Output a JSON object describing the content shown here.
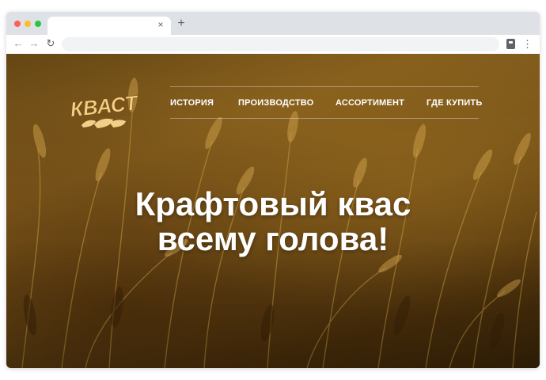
{
  "browser": {
    "tab_close": "×",
    "new_tab": "+",
    "back": "←",
    "forward": "→",
    "reload": "↻",
    "menu": "⋮",
    "address": ""
  },
  "site": {
    "logo_text": "КВАСТ",
    "nav": [
      {
        "label": "ИСТОРИЯ"
      },
      {
        "label": "ПРОИЗВОДСТВО"
      },
      {
        "label": "АССОРТИМЕНТ"
      },
      {
        "label": "ГДЕ КУПИТЬ"
      }
    ],
    "hero": {
      "line1": "Крафтовый квас",
      "line2": "всему голова!"
    }
  },
  "colors": {
    "logo": "#f3d089",
    "nav_text": "#ffffff",
    "hero_text": "#ffffff"
  },
  "icons": {
    "back": "arrow-left-icon",
    "forward": "arrow-right-icon",
    "reload": "reload-icon",
    "extension": "clipboard-icon",
    "menu": "kebab-menu-icon",
    "logo_bread": "bread-icon"
  }
}
